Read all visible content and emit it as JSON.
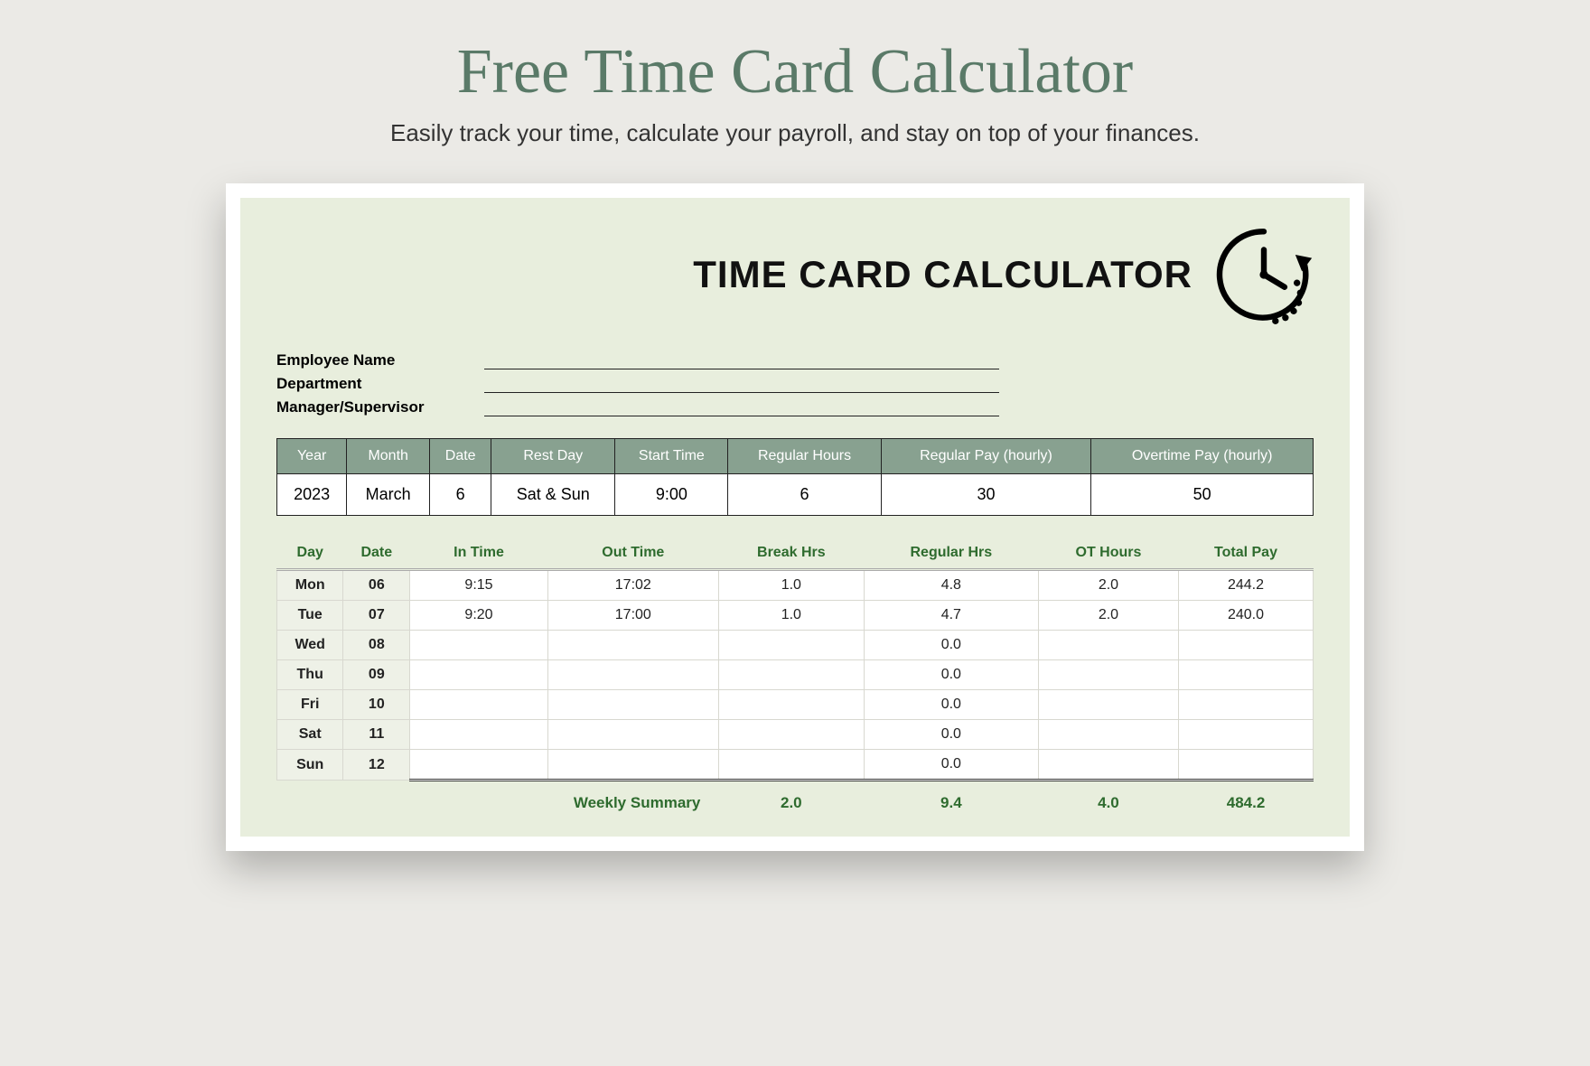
{
  "page": {
    "title": "Free Time Card Calculator",
    "subtitle": "Easily track your time, calculate your payroll, and stay on top of your finances."
  },
  "card": {
    "title": "TIME CARD CALCULATOR",
    "icon": "clock-time-icon",
    "info_labels": {
      "employee": "Employee Name",
      "department": "Department",
      "manager": "Manager/Supervisor"
    },
    "settings": {
      "headers": [
        "Year",
        "Month",
        "Date",
        "Rest Day",
        "Start Time",
        "Regular Hours",
        "Regular Pay (hourly)",
        "Overtime Pay (hourly)"
      ],
      "values": [
        "2023",
        "March",
        "6",
        "Sat & Sun",
        "9:00",
        "6",
        "30",
        "50"
      ]
    },
    "timesheet": {
      "headers": [
        "Day",
        "Date",
        "In Time",
        "Out Time",
        "Break Hrs",
        "Regular Hrs",
        "OT Hours",
        "Total Pay"
      ],
      "rows": [
        {
          "day": "Mon",
          "date": "06",
          "in": "9:15",
          "out": "17:02",
          "break": "1.0",
          "reg": "4.8",
          "ot": "2.0",
          "total": "244.2"
        },
        {
          "day": "Tue",
          "date": "07",
          "in": "9:20",
          "out": "17:00",
          "break": "1.0",
          "reg": "4.7",
          "ot": "2.0",
          "total": "240.0"
        },
        {
          "day": "Wed",
          "date": "08",
          "in": "",
          "out": "",
          "break": "",
          "reg": "0.0",
          "ot": "",
          "total": ""
        },
        {
          "day": "Thu",
          "date": "09",
          "in": "",
          "out": "",
          "break": "",
          "reg": "0.0",
          "ot": "",
          "total": ""
        },
        {
          "day": "Fri",
          "date": "10",
          "in": "",
          "out": "",
          "break": "",
          "reg": "0.0",
          "ot": "",
          "total": ""
        },
        {
          "day": "Sat",
          "date": "11",
          "in": "",
          "out": "",
          "break": "",
          "reg": "0.0",
          "ot": "",
          "total": ""
        },
        {
          "day": "Sun",
          "date": "12",
          "in": "",
          "out": "",
          "break": "",
          "reg": "0.0",
          "ot": "",
          "total": ""
        }
      ],
      "summary_label": "Weekly Summary",
      "summary": {
        "break": "2.0",
        "reg": "9.4",
        "ot": "4.0",
        "total": "484.2"
      }
    }
  },
  "colors": {
    "accent": "#5a7a68",
    "table_header": "#88a190",
    "bg": "#ebeae6",
    "card_bg": "#e8eedd",
    "text_green": "#2e6b2e"
  }
}
